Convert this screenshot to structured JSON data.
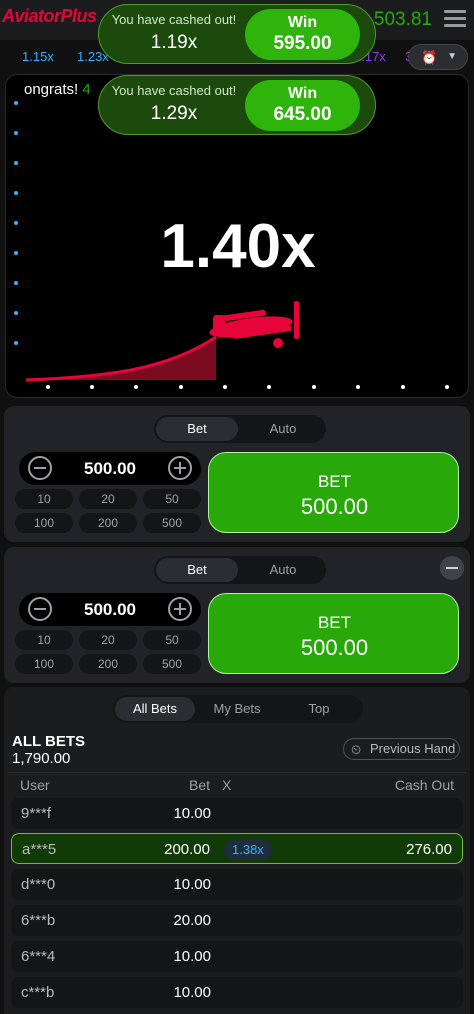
{
  "header": {
    "logo": "AviatorPlus",
    "balance": "503.81"
  },
  "history": [
    "1.15x",
    "1.23x",
    "1.17x",
    "3."
  ],
  "history_colors": [
    "#34b4ff",
    "#34b4ff",
    "#913ef8",
    "#913ef8"
  ],
  "game": {
    "multiplier": "1.40x",
    "congrats_prefix": "ongrats! ",
    "congrats_suffix": "4"
  },
  "toasts": [
    {
      "message": "You have cashed out!",
      "multiplier": "1.19x",
      "win_label": "Win",
      "win_amount": "595.00"
    },
    {
      "message": "You have cashed out!",
      "multiplier": "1.29x",
      "win_label": "Win",
      "win_amount": "645.00"
    }
  ],
  "panels": [
    {
      "tab_bet": "Bet",
      "tab_auto": "Auto",
      "amount": "500.00",
      "chips": [
        "10",
        "20",
        "50",
        "100",
        "200",
        "500"
      ],
      "bet_label": "BET",
      "bet_amount": "500.00"
    },
    {
      "tab_bet": "Bet",
      "tab_auto": "Auto",
      "amount": "500.00",
      "chips": [
        "10",
        "20",
        "50",
        "100",
        "200",
        "500"
      ],
      "bet_label": "BET",
      "bet_amount": "500.00"
    }
  ],
  "bets": {
    "tabs": [
      "All Bets",
      "My Bets",
      "Top"
    ],
    "title": "ALL BETS",
    "count": "1,790.00",
    "previous_hand": "Previous Hand",
    "columns": {
      "user": "User",
      "bet": "Bet",
      "x": "X",
      "cashout": "Cash Out"
    },
    "rows": [
      {
        "user": "9***f",
        "bet": "10.00",
        "x": "",
        "cashout": ""
      },
      {
        "user": "a***5",
        "bet": "200.00",
        "x": "1.38x",
        "cashout": "276.00",
        "won": true
      },
      {
        "user": "d***0",
        "bet": "10.00",
        "x": "",
        "cashout": ""
      },
      {
        "user": "6***b",
        "bet": "20.00",
        "x": "",
        "cashout": ""
      },
      {
        "user": "6***4",
        "bet": "10.00",
        "x": "",
        "cashout": ""
      },
      {
        "user": "c***b",
        "bet": "10.00",
        "x": "",
        "cashout": ""
      }
    ]
  },
  "colors": {
    "accent_red": "#e50539",
    "win_green": "#28a909",
    "blue": "#34b4ff",
    "purple": "#913ef8"
  },
  "icons": [
    "menu-icon",
    "clock-icon",
    "chevron-down-icon",
    "minus-icon",
    "plus-icon",
    "plane-icon"
  ]
}
